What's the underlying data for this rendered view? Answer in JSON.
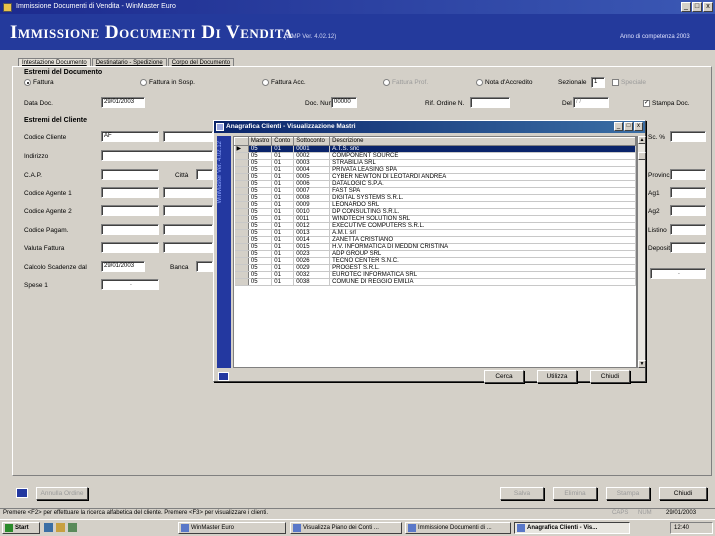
{
  "window": {
    "title": "Immissione Documenti di Vendita - WinMaster Euro",
    "btn_min": "_",
    "btn_max": "□",
    "btn_close": "x"
  },
  "banner": {
    "title": "Immissione Documenti Di Vendita",
    "version": "(WMP Ver. 4.02.12)",
    "year": "Anno di competenza 2003"
  },
  "tabs": [
    "Intestazione Documento",
    "Destinatario - Spedizione",
    "Corpo del Documento"
  ],
  "estremi_doc": {
    "header": "Estremi del Documento",
    "radios": [
      {
        "label": "Fattura",
        "checked": true,
        "disabled": false
      },
      {
        "label": "Fattura in Sosp.",
        "checked": false,
        "disabled": false
      },
      {
        "label": "Fattura Acc.",
        "checked": false,
        "disabled": false
      },
      {
        "label": "Fattura Prof.",
        "checked": false,
        "disabled": true
      },
      {
        "label": "Nota d'Accredito",
        "checked": false,
        "disabled": false
      }
    ],
    "sezionale_label": "Sezionale",
    "sezionale_value": "1",
    "speciale_label": "Speciale",
    "data_doc_label": "Data Doc.",
    "data_doc_value": "29/01/2003",
    "doc_numero_label": "Doc. Numero",
    "doc_numero_value": "00000",
    "rif_ordine_label": "Rif. Ordine N.",
    "rif_ordine_value": "",
    "del_label": "Del",
    "del_value": "/ /",
    "stampa_label": "Stampa Doc.",
    "stampa_checked": true
  },
  "estremi_cli": {
    "header": "Estremi del Cliente",
    "codice_cliente_label": "Codice Cliente",
    "codice_cliente_value": "AF",
    "indirizzo_label": "Indirizzo",
    "cap_label": "C.A.P.",
    "citta_label": "Città",
    "agente1_label": "Codice Agente 1",
    "agente2_label": "Codice Agente 2",
    "pagam_label": "Codice Pagam.",
    "valuta_label": "Valuta Fattura",
    "calcolo_label": "Calcolo Scadenze dal",
    "calcolo_value": "29/01/2003",
    "banca_label": "Banca",
    "spese_label": "Spese 1",
    "spese_value": ".",
    "right_labels": [
      "Sc. %",
      "Provincia",
      "Ag1",
      "Ag2",
      "Listino",
      "Deposito"
    ],
    "right_value": "."
  },
  "dialog": {
    "title": "Anagrafica Clienti - Visualizzazione Mastri",
    "sidebar_text": "WinMaster Ver. 4.02.12",
    "columns": [
      "Mastro",
      "Conto",
      "Sottoconto",
      "Descrizione"
    ],
    "rows": [
      [
        "05",
        "01",
        "0001",
        "A.T.S. snc"
      ],
      [
        "05",
        "01",
        "0002",
        "COMPONENT SOURCE"
      ],
      [
        "05",
        "01",
        "0003",
        "STRABILIA SRL"
      ],
      [
        "05",
        "01",
        "0004",
        "PRIVATA LEASING SPA"
      ],
      [
        "05",
        "01",
        "0005",
        "CYBER NEWTON DI LEOTARDI ANDREA"
      ],
      [
        "05",
        "01",
        "0006",
        "DATALOGIC S.P.A."
      ],
      [
        "05",
        "01",
        "0007",
        "FAST SPA"
      ],
      [
        "05",
        "01",
        "0008",
        "DIGITAL SYSTEMS S.R.L."
      ],
      [
        "05",
        "01",
        "0009",
        "LEONARDO SRL"
      ],
      [
        "05",
        "01",
        "0010",
        "DP CONSULTING S.R.L."
      ],
      [
        "05",
        "01",
        "0011",
        "WINDTECH SOLUTION SRL"
      ],
      [
        "05",
        "01",
        "0012",
        "EXECUTIVE COMPUTERS S.R.L."
      ],
      [
        "05",
        "01",
        "0013",
        "A.M.I. srl"
      ],
      [
        "05",
        "01",
        "0014",
        "ZANETTA CRISTIANO"
      ],
      [
        "05",
        "01",
        "0015",
        "H.V. INFORMATICA DI MEDDNI CRISTINA"
      ],
      [
        "05",
        "01",
        "0023",
        "ADP GROUP SRL"
      ],
      [
        "05",
        "01",
        "0026",
        "TECNO CENTER S.N.C."
      ],
      [
        "05",
        "01",
        "0029",
        "PROGEST S.R.L."
      ],
      [
        "05",
        "01",
        "0032",
        "EUROTEC INFORMATICA SRL"
      ],
      [
        "05",
        "01",
        "0038",
        "COMUNE DI REGGIO EMILIA"
      ]
    ],
    "btn_cerca": "Cerca",
    "btn_utilizza": "Utilizza",
    "btn_chiudi": "Chiudi"
  },
  "bottom": {
    "btn_annulla": "Annulla Ordine",
    "btn_salva": "Salva",
    "btn_elimina": "Elimina",
    "btn_stampa": "Stampa",
    "btn_chiudi": "Chiudi"
  },
  "status": {
    "text": "Premere <F2> per effettuare la ricerca alfabetica del cliente. Premere <F3> per visualizzare i clienti.",
    "caps": "CAPS",
    "num": "NUM",
    "date": "29/01/2003"
  },
  "taskbar": {
    "start": "Start",
    "items": [
      {
        "label": "WinMaster Euro",
        "active": false
      },
      {
        "label": "Visualizza Piano dei Conti ...",
        "active": false
      },
      {
        "label": "Immissione Documenti di ...",
        "active": false
      },
      {
        "label": "Anagrafica Clienti - Vis...",
        "active": true
      }
    ],
    "clock": "12:40"
  }
}
